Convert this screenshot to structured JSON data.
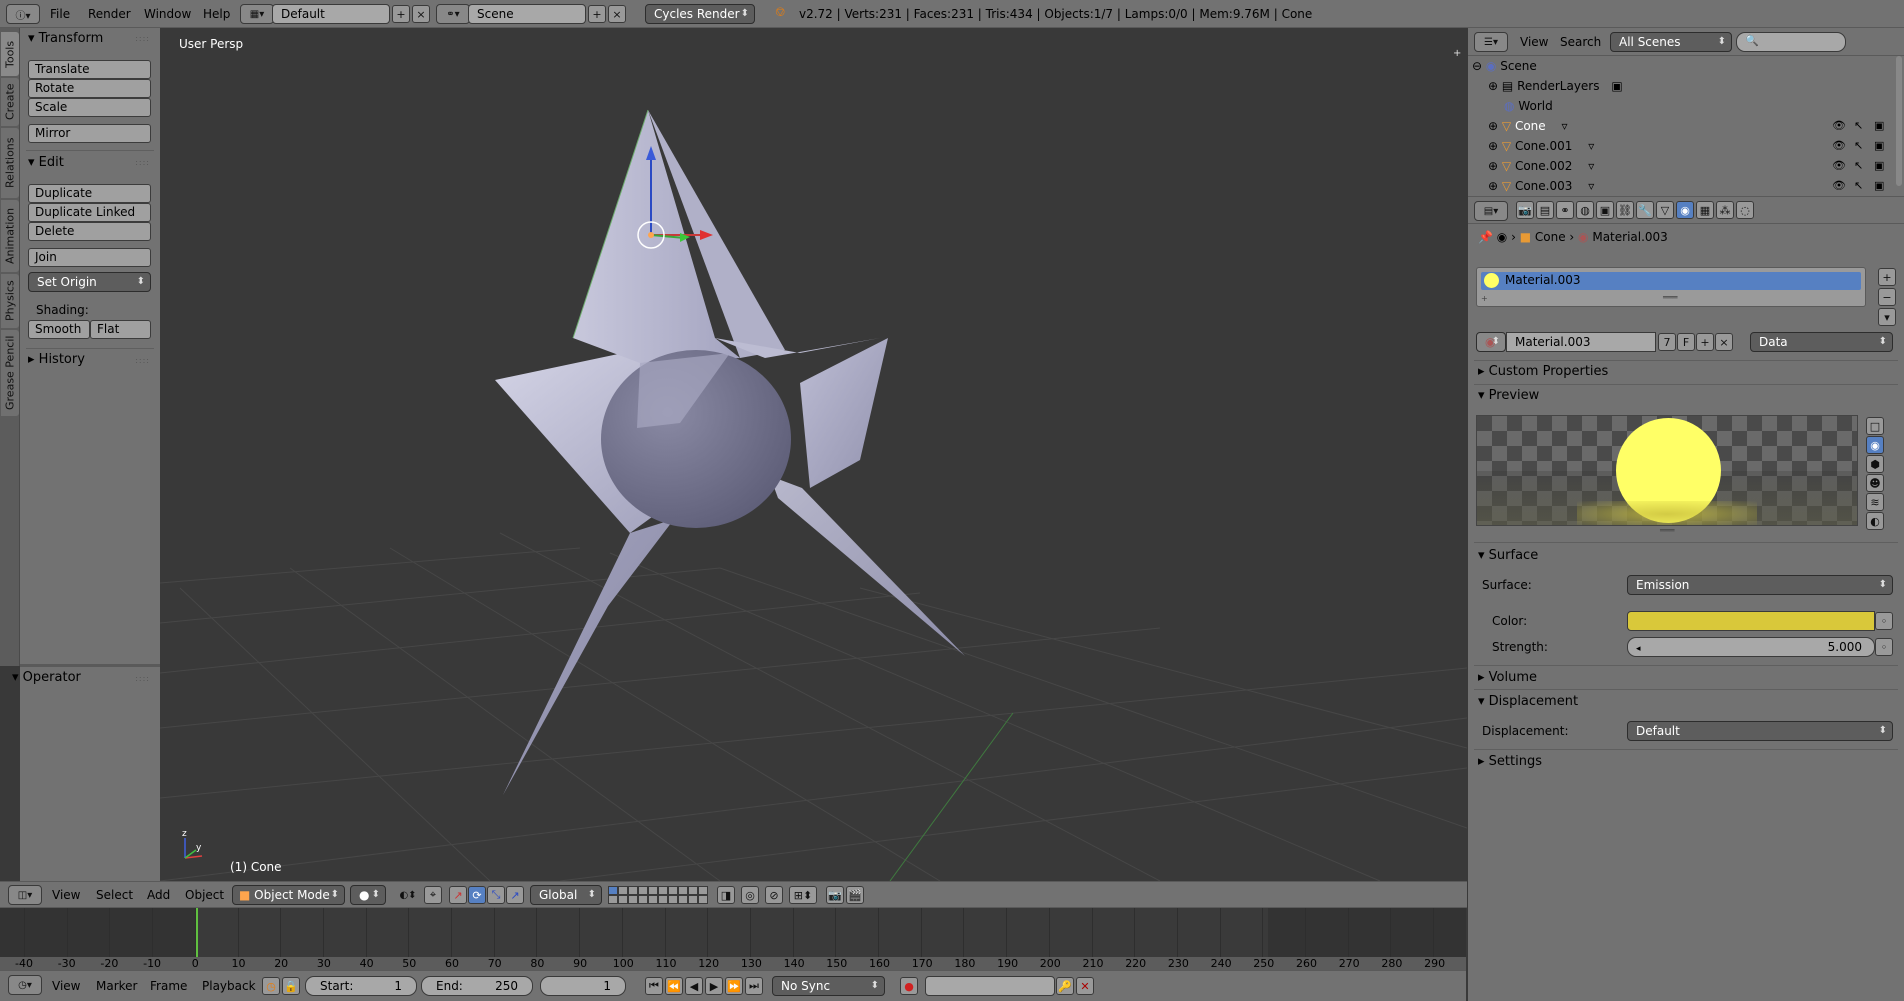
{
  "info_header": {
    "menus": [
      "File",
      "Render",
      "Window",
      "Help"
    ],
    "layout": "Default",
    "scene": "Scene",
    "engine": "Cycles Render",
    "stats": "v2.72 | Verts:231 | Faces:231 | Tris:434 | Objects:1/7 | Lamps:0/0 | Mem:9.76M | Cone"
  },
  "toolshelf": {
    "tabs": [
      "Tools",
      "Create",
      "Relations",
      "Animation",
      "Physics",
      "Grease Pencil"
    ],
    "transform_title": "Transform",
    "translate": "Translate",
    "rotate": "Rotate",
    "scale": "Scale",
    "mirror": "Mirror",
    "edit_title": "Edit",
    "duplicate": "Duplicate",
    "duplicate_linked": "Duplicate Linked",
    "delete": "Delete",
    "join": "Join",
    "set_origin": "Set Origin",
    "shading_label": "Shading:",
    "smooth": "Smooth",
    "flat": "Flat",
    "history_title": "History",
    "operator_title": "Operator"
  },
  "viewport": {
    "view_label": "User Persp",
    "object_label": "(1) Cone"
  },
  "view3d_header": {
    "menus": [
      "View",
      "Select",
      "Add",
      "Object"
    ],
    "mode": "Object Mode",
    "orientation": "Global"
  },
  "timeline": {
    "ticks": [
      "-40",
      "-30",
      "-20",
      "-10",
      "0",
      "10",
      "20",
      "30",
      "40",
      "50",
      "60",
      "70",
      "80",
      "90",
      "100",
      "110",
      "120",
      "130",
      "140",
      "150",
      "160",
      "170",
      "180",
      "190",
      "200",
      "210",
      "220",
      "230",
      "240",
      "250",
      "260",
      "270",
      "280",
      "290"
    ],
    "menus": [
      "View",
      "Marker",
      "Frame",
      "Playback"
    ],
    "start_label": "Start:",
    "start": "1",
    "end_label": "End:",
    "end": "250",
    "current": "1",
    "sync": "No Sync"
  },
  "outliner": {
    "menus": [
      "View",
      "Search"
    ],
    "filter": "All Scenes",
    "items": [
      {
        "label": "Scene"
      },
      {
        "label": "RenderLayers"
      },
      {
        "label": "World"
      },
      {
        "label": "Cone"
      },
      {
        "label": "Cone.001"
      },
      {
        "label": "Cone.002"
      },
      {
        "label": "Cone.003"
      }
    ]
  },
  "properties": {
    "breadcrumb": [
      "Cone",
      "Material.003"
    ],
    "slot": "Material.003",
    "material_name": "Material.003",
    "users": "7",
    "fake_user": "F",
    "link": "Data",
    "custom_props": "Custom Properties",
    "preview": "Preview",
    "surface_title": "Surface",
    "surface_label": "Surface:",
    "surface_value": "Emission",
    "color_label": "Color:",
    "emission_color": "#d9c83a",
    "strength_label": "Strength:",
    "strength_value": "5.000",
    "volume": "Volume",
    "displacement_title": "Displacement",
    "displacement_label": "Displacement:",
    "displacement_value": "Default",
    "settings": "Settings"
  },
  "colors": {
    "selection_blue": "#5680c2",
    "active_orange": "#ffa54d",
    "sphere_yellow": "#ffff66"
  }
}
